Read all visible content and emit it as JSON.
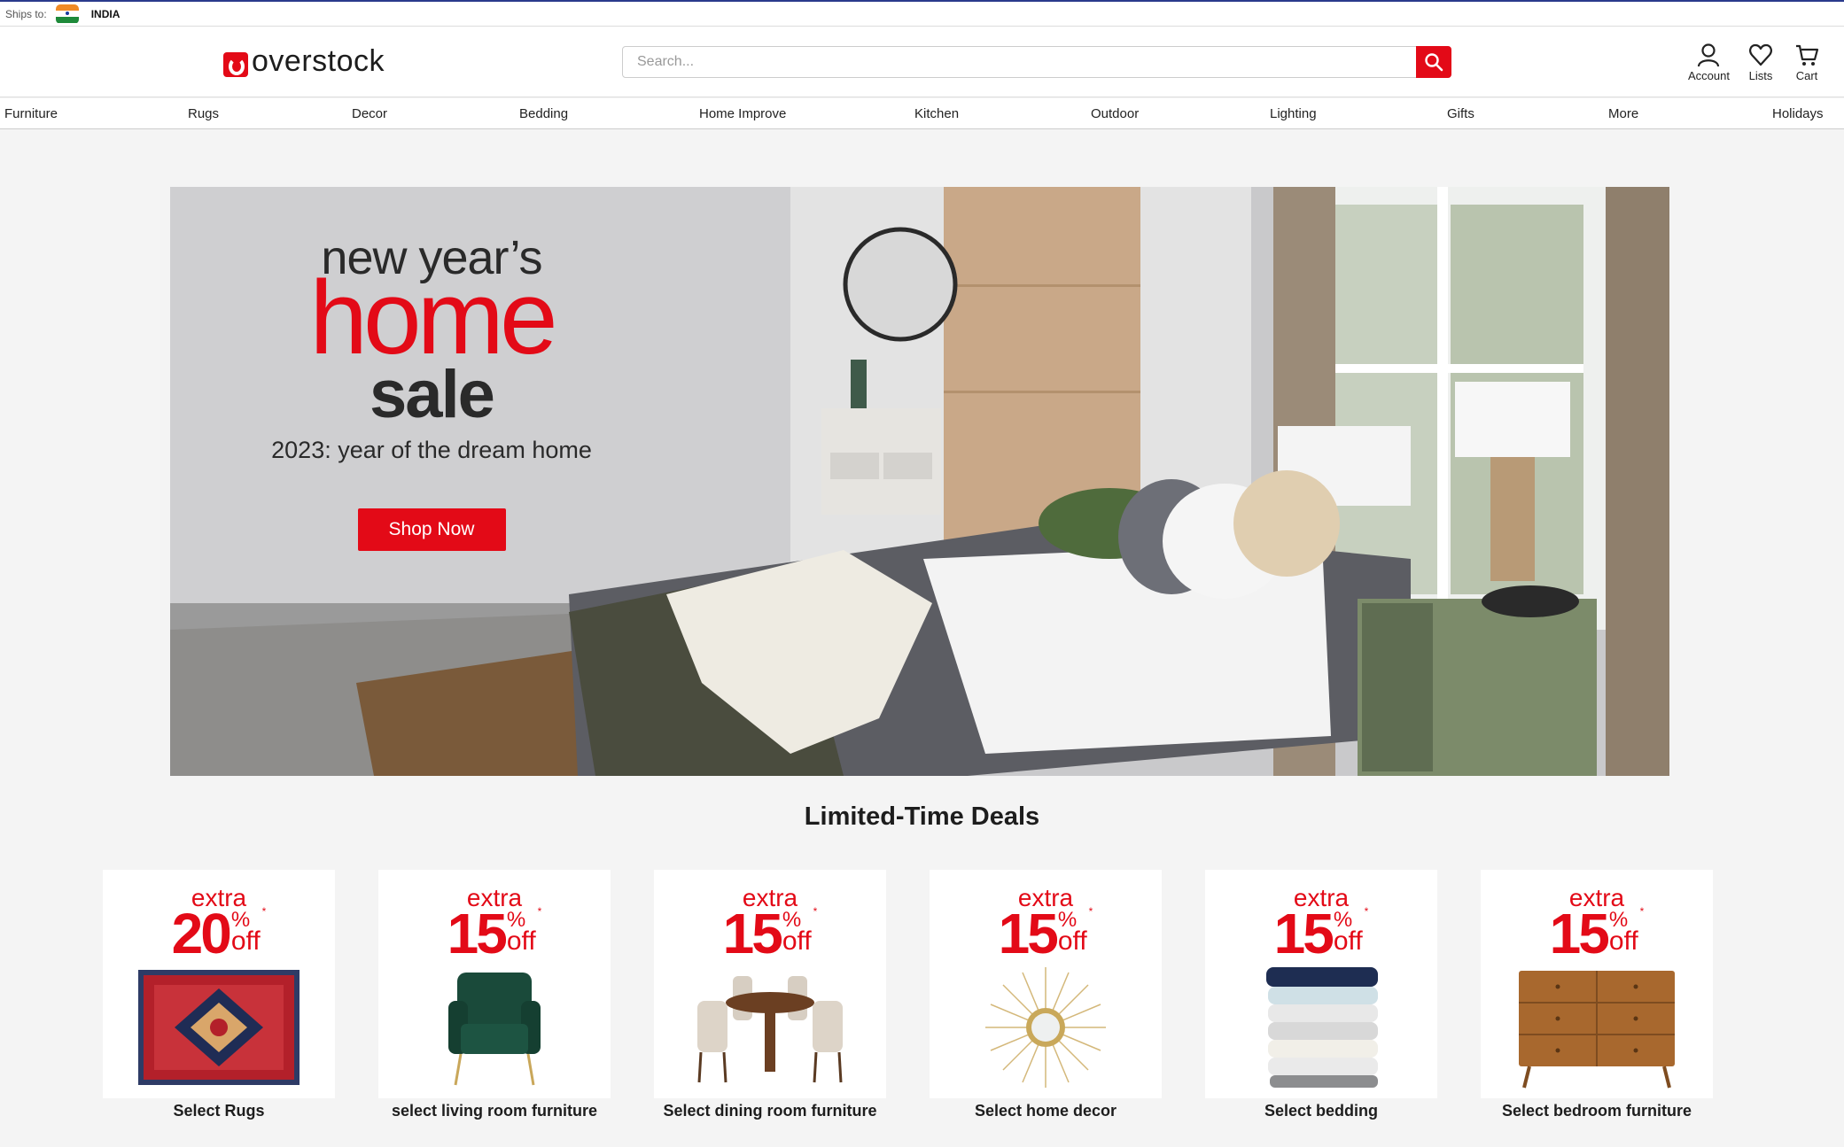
{
  "top_strip": {
    "ships_label": "Ships to:",
    "country": "INDIA",
    "flag_icon": "india-flag-icon"
  },
  "header": {
    "logo_text": "overstock",
    "search_placeholder": "Search...",
    "account_label": "Account",
    "lists_label": "Lists",
    "cart_label": "Cart"
  },
  "nav": {
    "items": [
      "Furniture",
      "Rugs",
      "Decor",
      "Bedding",
      "Home Improve",
      "Kitchen",
      "Outdoor",
      "Lighting",
      "Gifts",
      "More",
      "Holidays"
    ]
  },
  "hero": {
    "line1": "new year’s",
    "line2": "home",
    "line3": "sale",
    "subtitle": "2023: year of the dream home",
    "button_label": "Shop Now"
  },
  "deals": {
    "title": "Limited-Time Deals",
    "items": [
      {
        "extra": "extra",
        "percent": "20",
        "pct_sign": "%",
        "off": "off",
        "asterisk": "*",
        "label": "Select Rugs",
        "image": "rug-image"
      },
      {
        "extra": "extra",
        "percent": "15",
        "pct_sign": "%",
        "off": "off",
        "asterisk": "*",
        "label": "select living room furniture",
        "image": "armchair-image"
      },
      {
        "extra": "extra",
        "percent": "15",
        "pct_sign": "%",
        "off": "off",
        "asterisk": "*",
        "label": "Select dining room furniture",
        "image": "dining-set-image"
      },
      {
        "extra": "extra",
        "percent": "15",
        "pct_sign": "%",
        "off": "off",
        "asterisk": "*",
        "label": "Select home decor",
        "image": "sunburst-mirror-image"
      },
      {
        "extra": "extra",
        "percent": "15",
        "pct_sign": "%",
        "off": "off",
        "asterisk": "*",
        "label": "Select bedding",
        "image": "folded-sheets-image"
      },
      {
        "extra": "extra",
        "percent": "15",
        "pct_sign": "%",
        "off": "off",
        "asterisk": "*",
        "label": "Select bedroom furniture",
        "image": "dresser-image"
      }
    ]
  },
  "colors": {
    "brand_red": "#e30a17",
    "top_border": "#2a3a8c",
    "page_bg": "#f4f4f4"
  }
}
